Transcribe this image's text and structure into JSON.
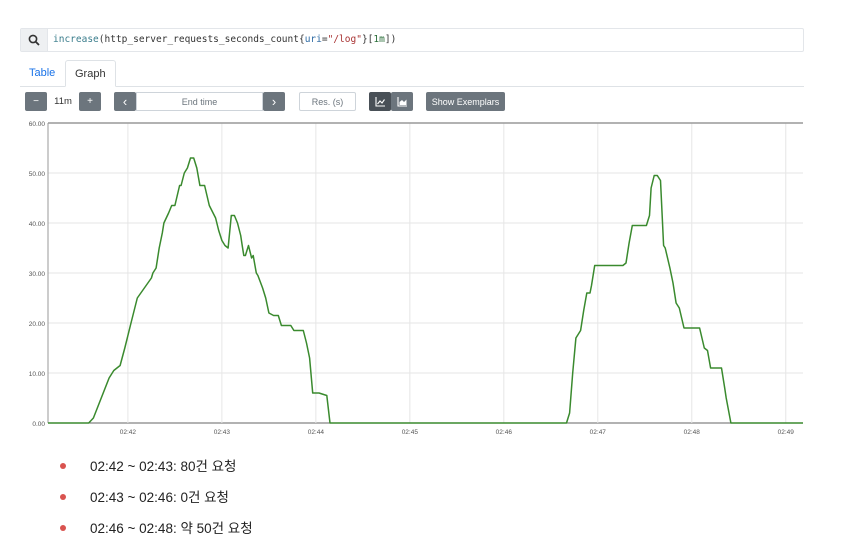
{
  "query": {
    "fn": "increase",
    "metric": "http_server_requests_seconds_count",
    "label_key": "uri",
    "label_value": "\"/log\"",
    "range": "1m"
  },
  "tabs": [
    {
      "label": "Table",
      "active": false
    },
    {
      "label": "Graph",
      "active": true
    }
  ],
  "controls": {
    "minus_label": "−",
    "range_value": "11m",
    "plus_label": "+",
    "prev_label": "‹",
    "end_time_placeholder": "End time",
    "next_label": "›",
    "resolution_placeholder": "Res. (s)",
    "line_icon": "line-chart-icon",
    "stacked_icon": "stacked-chart-icon",
    "exemplars_label": "Show Exemplars"
  },
  "colors": {
    "series": "#3a8a2e",
    "bullet": "#d9534f",
    "link": "#1a73e8"
  },
  "chart_data": {
    "type": "line",
    "x_ticks": [
      "02:42",
      "02:43",
      "02:44",
      "02:45",
      "02:46",
      "02:47",
      "02:48",
      "02:49"
    ],
    "y_ticks": [
      "0.00",
      "10.00",
      "20.00",
      "30.00",
      "40.00",
      "50.00",
      "60.00"
    ],
    "ylim": [
      0,
      60
    ],
    "xlim": [
      "02:41:09",
      "02:49:11"
    ],
    "grid": true,
    "series": [
      {
        "x": [
          "02:41:09",
          "02:41:35",
          "02:41:38",
          "02:41:48",
          "02:41:51",
          "02:41:55",
          "02:41:58",
          "02:42:02",
          "02:42:06",
          "02:42:15",
          "02:42:16",
          "02:42:18",
          "02:42:20",
          "02:42:22",
          "02:42:23",
          "02:42:26",
          "02:42:28",
          "02:42:30",
          "02:42:33",
          "02:42:34",
          "02:42:36",
          "02:42:38",
          "02:42:40",
          "02:42:42",
          "02:42:44",
          "02:42:46",
          "02:42:48",
          "02:42:49",
          "02:42:52",
          "02:42:56",
          "02:42:58",
          "02:43:00",
          "02:43:02",
          "02:43:04",
          "02:43:06",
          "02:43:08",
          "02:43:10",
          "02:43:12",
          "02:43:13",
          "02:43:14",
          "02:43:15",
          "02:43:17",
          "02:43:19",
          "02:43:20",
          "02:43:22",
          "02:43:23",
          "02:43:26",
          "02:43:28",
          "02:43:30",
          "02:43:33",
          "02:43:36",
          "02:43:38",
          "02:43:40",
          "02:43:44",
          "02:43:46",
          "02:43:48",
          "02:43:50",
          "02:43:52",
          "02:43:54",
          "02:43:56",
          "02:43:58",
          "02:44:00",
          "02:44:02",
          "02:44:07",
          "02:44:09",
          "02:44:10",
          "02:46:38",
          "02:46:40",
          "02:46:42",
          "02:46:44",
          "02:46:46",
          "02:46:49",
          "02:46:51",
          "02:46:53",
          "02:46:55",
          "02:46:56",
          "02:46:58",
          "02:47:00",
          "02:47:02",
          "02:47:16",
          "02:47:18",
          "02:47:20",
          "02:47:22",
          "02:47:25",
          "02:47:31",
          "02:47:33",
          "02:47:34",
          "02:47:36",
          "02:47:38",
          "02:47:40",
          "02:47:42",
          "02:47:43",
          "02:47:46",
          "02:47:48",
          "02:47:50",
          "02:47:52",
          "02:47:55",
          "02:47:57",
          "02:48:04",
          "02:48:05",
          "02:48:08",
          "02:48:10",
          "02:48:12",
          "02:48:15",
          "02:48:17",
          "02:48:19",
          "02:48:21",
          "02:48:22",
          "02:48:25",
          "02:49:11"
        ],
        "y": [
          0,
          0,
          1,
          9,
          10.5,
          11.5,
          15,
          20,
          25,
          29,
          30,
          31,
          35,
          38,
          40,
          42,
          43.5,
          43.5,
          47.5,
          47.5,
          50,
          51,
          53,
          53,
          51,
          47.5,
          47.5,
          47.5,
          43.5,
          41,
          38.5,
          36.5,
          35.5,
          35,
          41.5,
          41.5,
          40,
          37.5,
          35.5,
          33.5,
          33.5,
          35.5,
          33,
          33.5,
          30,
          29.5,
          27,
          25,
          22,
          21.5,
          21.5,
          19.5,
          19.5,
          19.5,
          18.5,
          18.5,
          18.5,
          18.5,
          16,
          13,
          6,
          6,
          6,
          5.5,
          0,
          0,
          0,
          0,
          2,
          10,
          17,
          18.5,
          22.5,
          26,
          26,
          27.5,
          31.5,
          31.5,
          31.5,
          31.5,
          32,
          36,
          39.5,
          39.5,
          39.5,
          41.5,
          47,
          49.5,
          49.5,
          48.5,
          35.5,
          35,
          31,
          28,
          24,
          23,
          19,
          19,
          19,
          19,
          15,
          14.5,
          11,
          11,
          11,
          11,
          7,
          5,
          0,
          0
        ]
      }
    ]
  },
  "bullets": [
    "02:42 ~ 02:43: 80건 요청",
    "02:43 ~ 02:46: 0건 요청",
    "02:46 ~ 02:48: 약 50건 요청"
  ]
}
